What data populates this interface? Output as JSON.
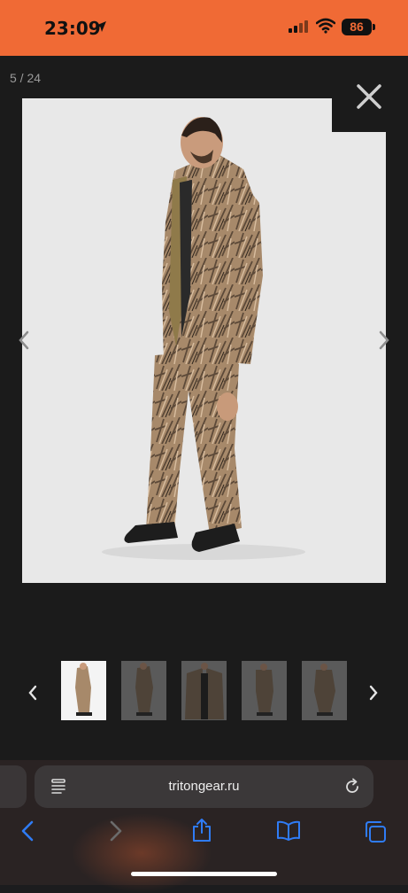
{
  "status_bar": {
    "time": "23:09",
    "battery": "86",
    "bg_color": "#f06a35"
  },
  "gallery": {
    "counter": "5 / 24",
    "current_index": 5,
    "total": 24,
    "close_icon": "close-icon",
    "prev_icon": "chevron-left-icon",
    "next_icon": "chevron-right-icon",
    "thumbnail_count": 5
  },
  "browser": {
    "url": "tritongear.ru",
    "reader_icon": "reader-mode-icon",
    "reload_icon": "reload-icon",
    "toolbar": [
      "back-icon",
      "forward-icon",
      "share-icon",
      "bookmarks-icon",
      "tabs-icon"
    ]
  },
  "colors": {
    "accent": "#2f7cf6",
    "disabled": "#6b6b6b"
  }
}
